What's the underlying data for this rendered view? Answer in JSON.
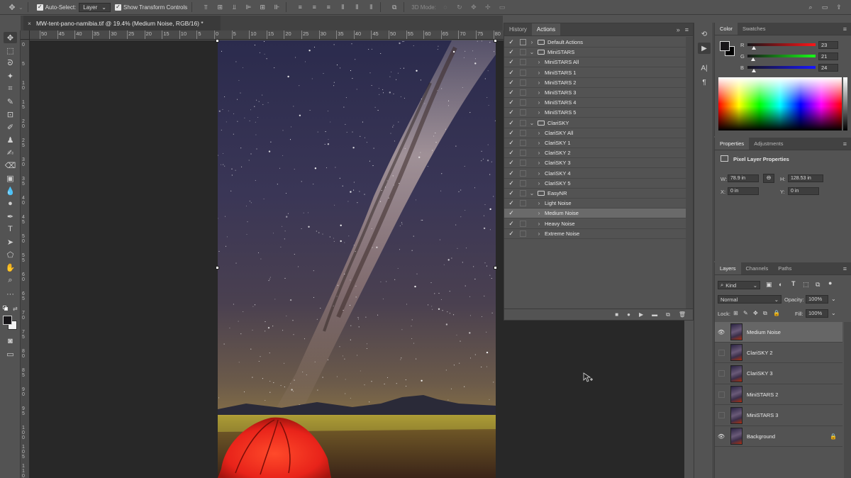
{
  "options_bar": {
    "auto_select_label": "Auto-Select:",
    "auto_select_value": "Layer",
    "transform_label": "Show Transform Controls",
    "mode_3d_label": "3D Mode:"
  },
  "document": {
    "tab_title": "MW-tent-pano-namibia.tif @ 19.4% (Medium Noise, RGB/16) *",
    "ruler_h_labels": [
      "50",
      "45",
      "40",
      "35",
      "30",
      "25",
      "20",
      "15",
      "10",
      "5",
      "0",
      "5",
      "10",
      "15",
      "20",
      "25",
      "30",
      "35",
      "40",
      "45",
      "50",
      "55",
      "60",
      "65",
      "70",
      "75",
      "80"
    ],
    "ruler_v_labels": [
      "0",
      "5",
      "1\n0",
      "1\n5",
      "2\n0",
      "2\n5",
      "3\n0",
      "3\n5",
      "4\n0",
      "4\n5",
      "5\n0",
      "5\n5",
      "6\n0",
      "6\n5",
      "7\n0",
      "7\n5",
      "8\n0",
      "8\n5",
      "9\n0",
      "9\n5",
      "1\n0\n0",
      "1\n0\n5",
      "1\n1\n0"
    ]
  },
  "actions_panel": {
    "tabs": [
      "History",
      "Actions"
    ],
    "active_tab": "Actions",
    "rows": [
      {
        "label": "Default Actions",
        "level": 0,
        "folder": true,
        "open": false
      },
      {
        "label": "MiniSTARS",
        "level": 0,
        "folder": true,
        "open": true
      },
      {
        "label": "MiniSTARS All",
        "level": 1
      },
      {
        "label": "MiniSTARS 1",
        "level": 1
      },
      {
        "label": "MiniSTARS 2",
        "level": 1
      },
      {
        "label": "MiniSTARS 3",
        "level": 1
      },
      {
        "label": "MiniSTARS 4",
        "level": 1
      },
      {
        "label": "MiniSTARS 5",
        "level": 1
      },
      {
        "label": "ClariSKY",
        "level": 0,
        "folder": true,
        "open": true
      },
      {
        "label": "ClariSKY All",
        "level": 1
      },
      {
        "label": "ClariSKY 1",
        "level": 1
      },
      {
        "label": "ClariSKY 2",
        "level": 1
      },
      {
        "label": "ClariSKY 3",
        "level": 1
      },
      {
        "label": "ClariSKY 4",
        "level": 1
      },
      {
        "label": "ClariSKY 5",
        "level": 1
      },
      {
        "label": "EasyNR",
        "level": 0,
        "folder": true,
        "open": true
      },
      {
        "label": "Light Noise",
        "level": 1
      },
      {
        "label": "Medium Noise",
        "level": 1,
        "selected": true
      },
      {
        "label": "Heavy Noise",
        "level": 1
      },
      {
        "label": "Extreme Noise",
        "level": 1
      }
    ]
  },
  "color_panel": {
    "tabs": [
      "Color",
      "Swatches"
    ],
    "r_label": "R",
    "g_label": "G",
    "b_label": "B",
    "r": "23",
    "g": "21",
    "b": "24",
    "r_fraction": 0.09,
    "g_fraction": 0.08,
    "b_fraction": 0.09
  },
  "properties_panel": {
    "tabs": [
      "Properties",
      "Adjustments"
    ],
    "title": "Pixel Layer Properties",
    "w_label": "W:",
    "w_value": "78.9 in",
    "h_label": "H:",
    "h_value": "128.53 in",
    "x_label": "X:",
    "x_value": "0 in",
    "y_label": "Y:",
    "y_value": "0 in"
  },
  "layers_panel": {
    "tabs": [
      "Layers",
      "Channels",
      "Paths"
    ],
    "kind_label": "Kind",
    "blend_mode": "Normal",
    "opacity_label": "Opacity:",
    "opacity_value": "100%",
    "lock_label": "Lock:",
    "fill_label": "Fill:",
    "fill_value": "100%",
    "layers": [
      {
        "name": "Medium Noise",
        "visible": true,
        "active": true
      },
      {
        "name": "ClariSKY 2",
        "visible": false
      },
      {
        "name": "ClariSKY 3",
        "visible": false
      },
      {
        "name": "MiniSTARS 2",
        "visible": false
      },
      {
        "name": "MiniSTARS 3",
        "visible": false
      },
      {
        "name": "Background",
        "visible": true,
        "locked": true
      }
    ]
  },
  "colors": {
    "panel_bg": "#535353",
    "pasteboard": "#282828",
    "tent_red": "#e8231a"
  }
}
